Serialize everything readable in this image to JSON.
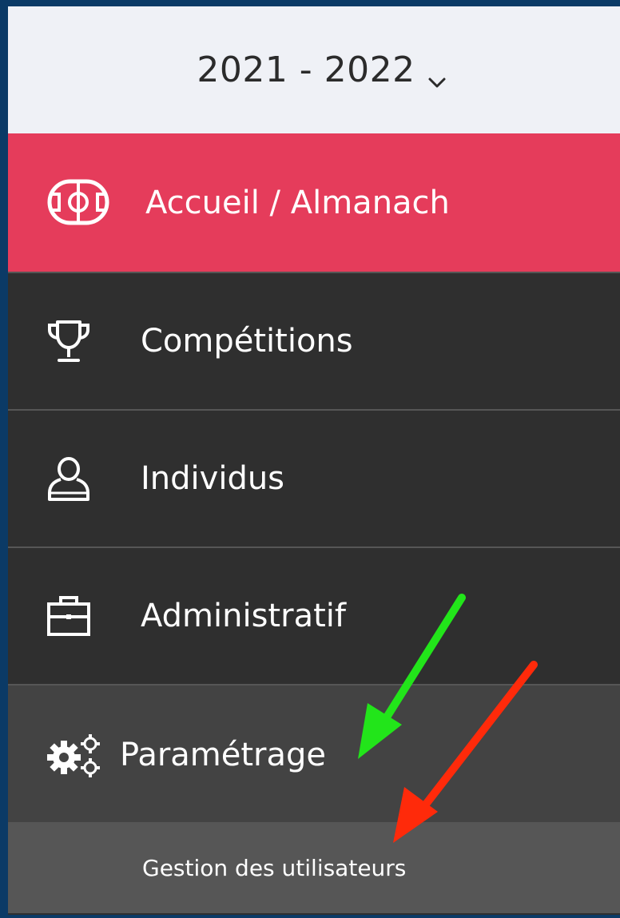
{
  "season": {
    "label": "2021 - 2022",
    "icon": "chevron-down-icon"
  },
  "menu": {
    "items": [
      {
        "label": "Accueil / Almanach",
        "icon": "football-field-icon",
        "active": true
      },
      {
        "label": "Compétitions",
        "icon": "trophy-icon"
      },
      {
        "label": "Individus",
        "icon": "user-icon"
      },
      {
        "label": "Administratif",
        "icon": "briefcase-icon"
      },
      {
        "label": "Paramétrage",
        "icon": "gears-icon",
        "expanded": true
      }
    ],
    "subitems": [
      {
        "label": "Gestion des utilisateurs"
      }
    ]
  },
  "colors": {
    "active": "#e53c5b",
    "dark": "#2f2f2f",
    "expanded": "#434343",
    "sub": "#565656",
    "header": "#eff1f6",
    "frame": "#0b3a66",
    "green_arrow": "#22e51a",
    "red_arrow": "#ff2a0a"
  },
  "annotations": [
    {
      "type": "arrow",
      "color": "green",
      "points_to": "Paramétrage"
    },
    {
      "type": "arrow",
      "color": "red",
      "points_to": "Gestion des utilisateurs"
    }
  ]
}
